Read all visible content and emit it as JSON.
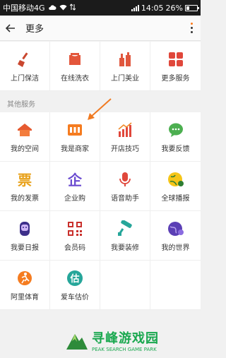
{
  "status_bar": {
    "carrier": "中国移动4G",
    "time": "14:05",
    "battery": "26%",
    "battery_level": 0.26
  },
  "header": {
    "title": "更多"
  },
  "top_grid": [
    {
      "label": "上门保洁",
      "icon": "broom-icon"
    },
    {
      "label": "在线洗衣",
      "icon": "laundry-icon"
    },
    {
      "label": "上门美业",
      "icon": "beauty-icon"
    },
    {
      "label": "更多服务",
      "icon": "more-services-icon"
    }
  ],
  "other_section": {
    "title": "其他服务",
    "items": [
      {
        "label": "我的空间",
        "icon": "house-icon"
      },
      {
        "label": "我是商家",
        "icon": "shop-icon"
      },
      {
        "label": "开店技巧",
        "icon": "growth-chart-icon"
      },
      {
        "label": "我要反馈",
        "icon": "chat-bubble-icon"
      },
      {
        "label": "我的发票",
        "icon": "invoice-icon",
        "glyph": "票"
      },
      {
        "label": "企业购",
        "icon": "enterprise-icon",
        "glyph": "企"
      },
      {
        "label": "语音助手",
        "icon": "microphone-icon"
      },
      {
        "label": "全球播报",
        "icon": "global-broadcast-icon"
      },
      {
        "label": "我要日报",
        "icon": "daily-report-icon"
      },
      {
        "label": "会员码",
        "icon": "qr-code-icon"
      },
      {
        "label": "我要装修",
        "icon": "paint-roller-icon"
      },
      {
        "label": "我的世界",
        "icon": "world-icon"
      },
      {
        "label": "阿里体育",
        "icon": "sports-icon"
      },
      {
        "label": "爱车估价",
        "icon": "car-value-icon",
        "glyph": "估"
      }
    ]
  },
  "watermark": {
    "title": "寻峰游戏园",
    "subtitle": "PEAK SEARCH GAME PARK"
  }
}
